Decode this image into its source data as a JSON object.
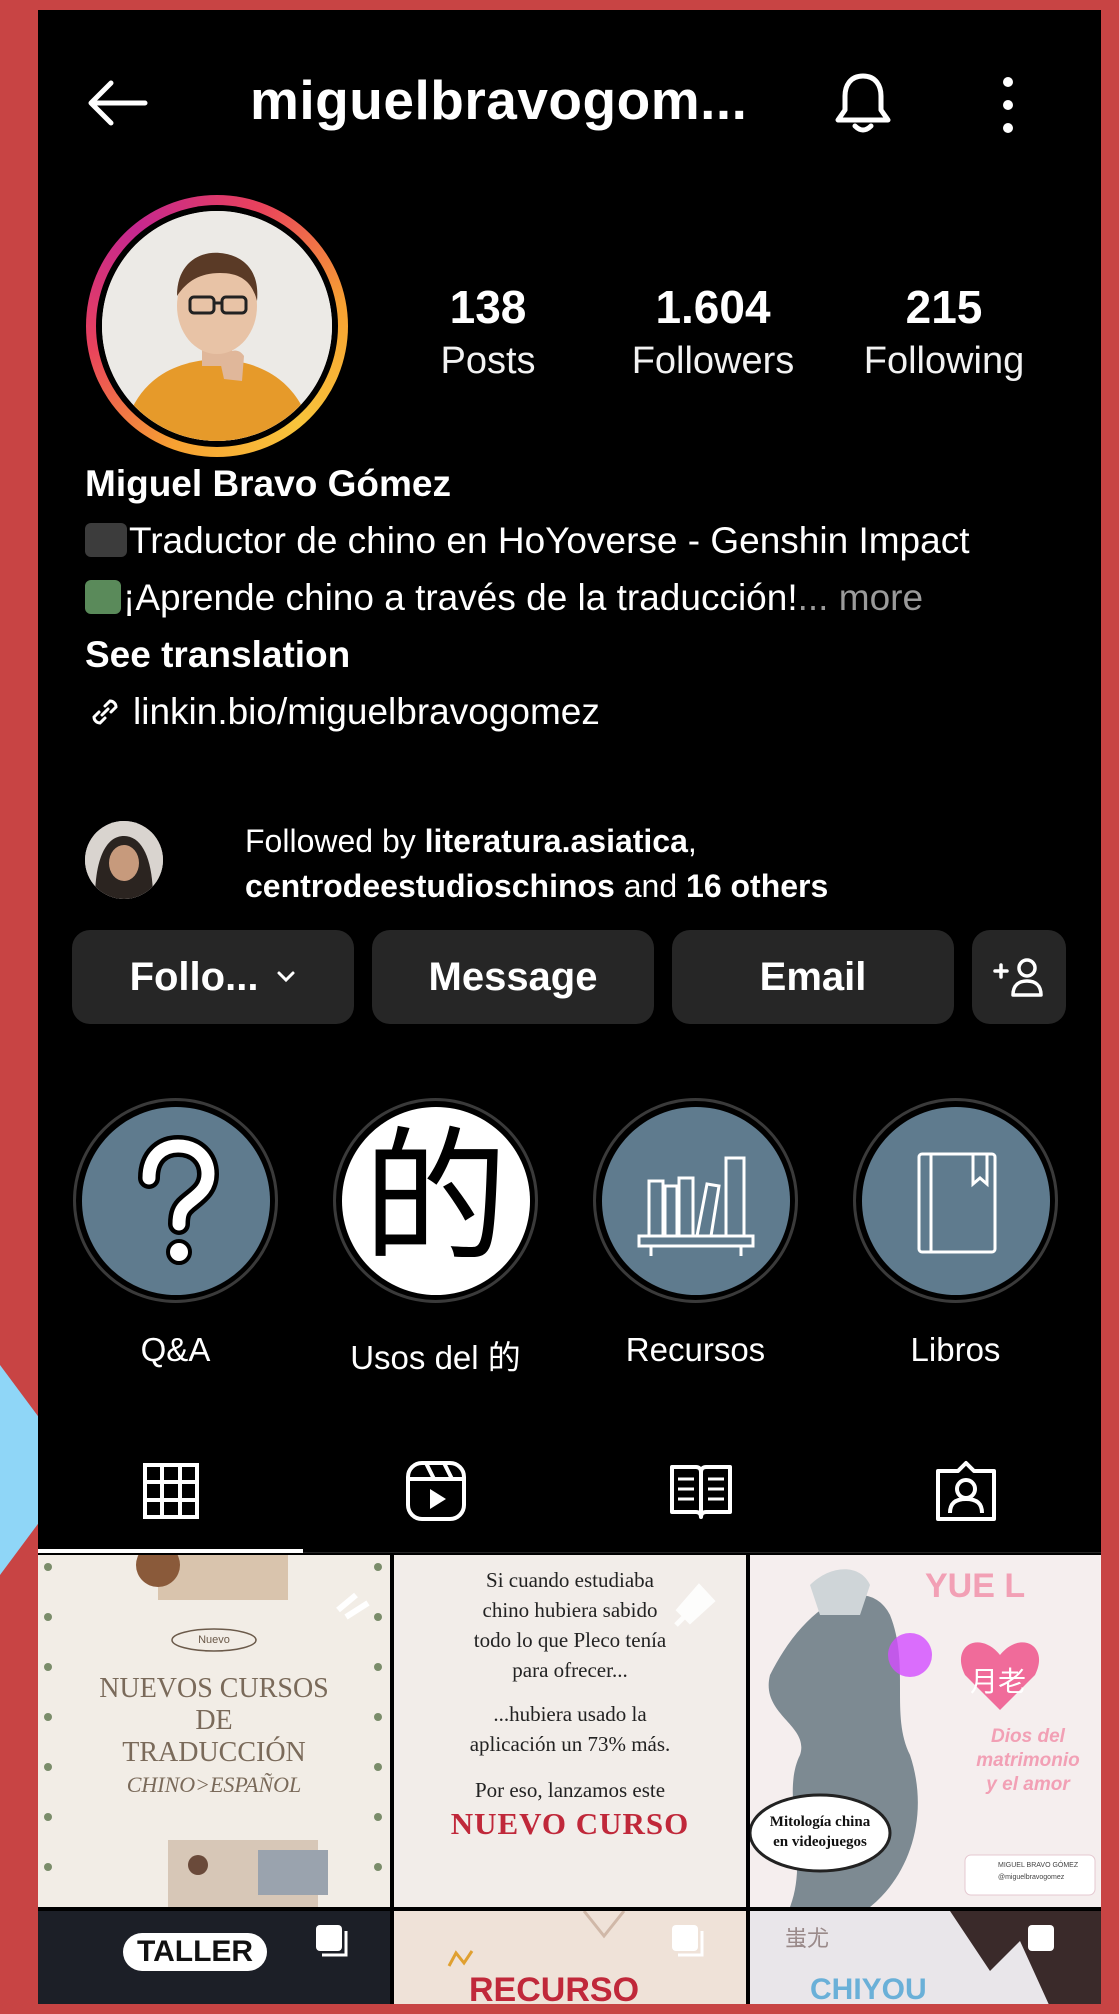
{
  "header": {
    "username": "miguelbravogom...",
    "back_icon": "back-arrow-icon",
    "bell_icon": "bell-icon",
    "more_icon": "more-vertical-icon"
  },
  "profile": {
    "stats": [
      {
        "value": "138",
        "label": "Posts"
      },
      {
        "value": "1.604",
        "label": "Followers"
      },
      {
        "value": "215",
        "label": "Following"
      }
    ],
    "name": "Miguel Bravo Gómez",
    "bio_line1": "Traductor de chino en HoYoverse - Genshin Impact",
    "bio_line2": "¡Aprende chino a través de la traducción!",
    "more": "... more",
    "see_translation": "See translation",
    "link": "linkin.bio/miguelbravogomez",
    "followed_prefix": "Followed by ",
    "followed_user1": "literatura.asiatica",
    "followed_sep": ",",
    "followed_user2": "centrodeestudioschinos",
    "followed_and": " and ",
    "followed_others": "16 others"
  },
  "buttons": {
    "following": "Follo...",
    "message": "Message",
    "email": "Email",
    "add_user_icon": "add-person-icon"
  },
  "highlights": [
    {
      "label": "Q&A",
      "icon": "question-icon"
    },
    {
      "label": "Usos del 的",
      "glyph": "的"
    },
    {
      "label": "Recursos",
      "icon": "bookshelf-icon"
    },
    {
      "label": "Libros",
      "icon": "book-icon"
    }
  ],
  "tabs": [
    {
      "name": "grid",
      "icon": "grid-icon"
    },
    {
      "name": "reels",
      "icon": "reels-icon"
    },
    {
      "name": "guides",
      "icon": "guides-icon"
    },
    {
      "name": "tagged",
      "icon": "tagged-icon"
    }
  ],
  "posts": {
    "p1": {
      "badge": "Nuevo",
      "l1": "NUEVOS CURSOS",
      "l2": "DE",
      "l3": "TRADUCCIÓN",
      "l4": "CHINO>ESPAÑOL"
    },
    "p2": {
      "l1": "Si cuando estudiaba",
      "l2": "chino hubiera sabido",
      "l3": "todo lo que Pleco tenía",
      "l4": "para ofrecer...",
      "l5": "...hubiera usado la",
      "l6": "aplicación un 73% más.",
      "l7": "Por eso, lanzamos este",
      "l8": "NUEVO CURSO"
    },
    "p3": {
      "top": "YUE L",
      "chars": "月老",
      "sub1": "Dios del",
      "sub2": "matrimonio",
      "sub3": "y el amor",
      "bubble1": "Mitología china",
      "bubble2": "en videojuegos",
      "footer1": "MIGUEL BRAVO GÓMEZ",
      "footer2": "@miguelbravogomez"
    },
    "p4": {
      "label": "TALLER"
    },
    "p5": {
      "label": "RECURSO"
    },
    "p6": {
      "chars": "蚩尤",
      "label": "CHIYOU"
    }
  },
  "colors": {
    "frame": "#c84444",
    "accent_arrow": "#8fd6f7",
    "button_bg": "#262626",
    "highlight_bg": "#5f7b8e",
    "curso_red": "#c0283a"
  }
}
